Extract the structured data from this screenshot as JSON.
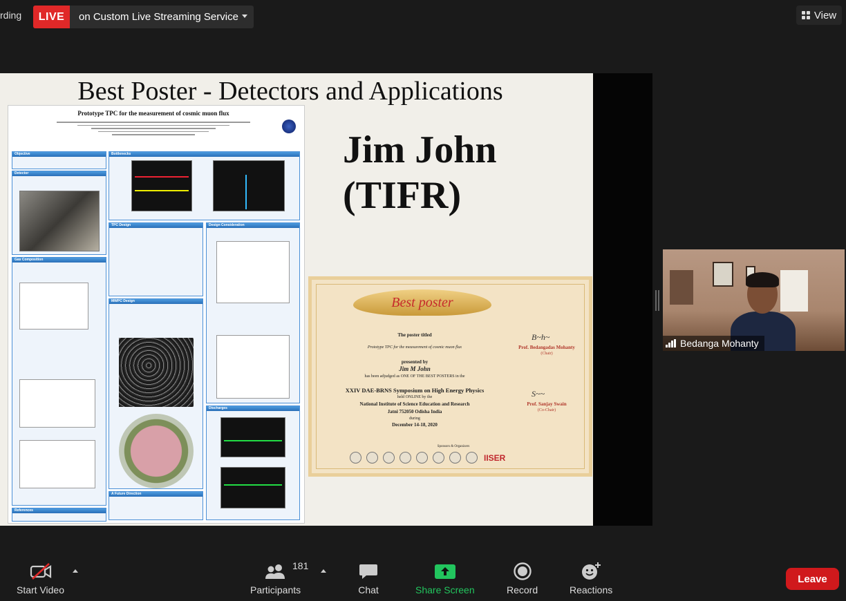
{
  "top_bar": {
    "recording_text": "rding",
    "live_label": "LIVE",
    "live_service": "on Custom Live Streaming Service",
    "view_label": "View"
  },
  "slide": {
    "title": "Best Poster - Detectors and Applications",
    "winner_name": "Jim John",
    "winner_affiliation": "(TIFR)",
    "poster": {
      "title": "Prototype TPC for the measurement of cosmic muon flux",
      "sections": [
        "Objective",
        "Detector",
        "Gas Composition",
        "References",
        "Bottlenecks",
        "TPC Design",
        "MWPC Design",
        "A Future Direction",
        "Design Consideration",
        "Discharges"
      ]
    },
    "certificate": {
      "ribbon": "Best poster",
      "line1": "The poster titled",
      "poster_title": "Prototype TPC for the measurement of cosmic muon flux",
      "presented_by": "presented by",
      "presenter": "Jim M John",
      "adjudged": "has been adjudged as ONE OF THE BEST POSTERS in the",
      "event": "XXIV DAE-BRNS Symposium on High Energy Physics",
      "held": "held ONLINE by the",
      "institute": "National Institute of Science Education and Research",
      "location": "Jatni 752050 Odisha India",
      "during": "during",
      "dates": "December 14-18, 2020",
      "chair_name": "Prof. Bedangadas Mohanty",
      "chair_role": "(Chair)",
      "cochair_name": "Prof. Sanjay Swain",
      "cochair_role": "(Co-Chair)",
      "sponsors_label": "Sponsors & Organizers",
      "sponsor_logo_text": "IISER"
    }
  },
  "participant_video": {
    "name": "Bedanga Mohanty"
  },
  "toolbar": {
    "start_video": "Start Video",
    "participants": "Participants",
    "participants_count": "181",
    "chat": "Chat",
    "share_screen": "Share Screen",
    "record": "Record",
    "reactions": "Reactions",
    "leave": "Leave"
  },
  "colors": {
    "live_red": "#e02828",
    "share_green": "#22c55e",
    "leave_red": "#d0191c",
    "poster_blue": "#2a6fb8"
  }
}
